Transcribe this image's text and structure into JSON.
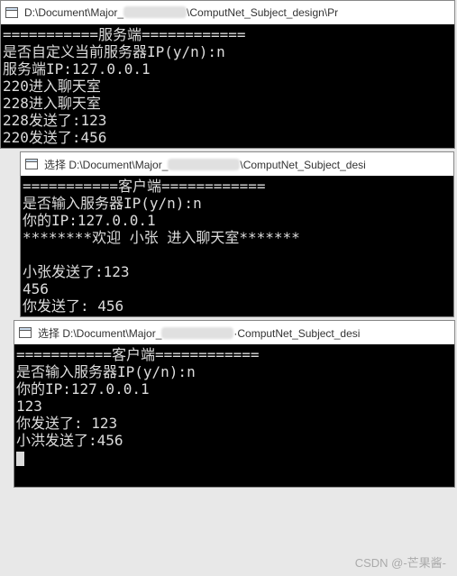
{
  "windows": [
    {
      "title_pre": "D:\\Document\\Major_",
      "title_post": "\\ComputNet_Subject_design\\Pr",
      "banner": "===========服务端============",
      "lines": [
        "是否自定义当前服务器IP(y/n):n",
        "服务端IP:127.0.0.1",
        "220进入聊天室",
        "228进入聊天室",
        "228发送了:123",
        "220发送了:456"
      ]
    },
    {
      "title_pre": "选择 D:\\Document\\Major_",
      "title_post": "\\ComputNet_Subject_desi",
      "banner": "===========客户端============",
      "lines": [
        "是否输入服务器IP(y/n):n",
        "你的IP:127.0.0.1",
        "********欢迎 小张 进入聊天室*******",
        "",
        "小张发送了:123",
        "456",
        "你发送了: 456"
      ]
    },
    {
      "title_pre": "选择 D:\\Document\\Major_",
      "title_post": "·ComputNet_Subject_desi",
      "banner": "===========客户端============",
      "lines": [
        "是否输入服务器IP(y/n):n",
        "你的IP:127.0.0.1",
        "123",
        "你发送了: 123",
        "小洪发送了:456"
      ]
    }
  ],
  "watermark": "CSDN @-芒果酱-"
}
